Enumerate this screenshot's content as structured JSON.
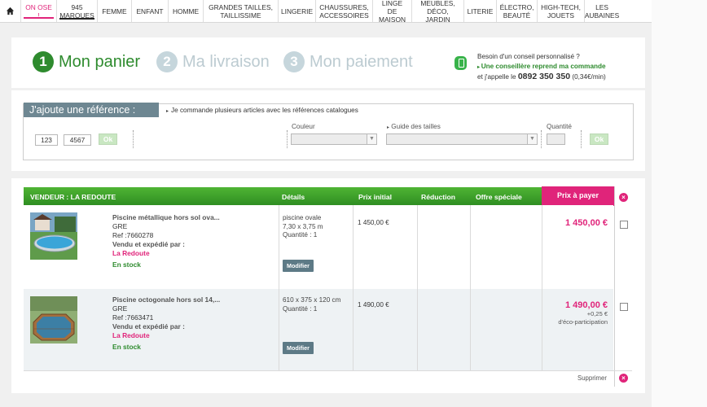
{
  "nav": {
    "items": [
      {
        "label": "ON OSE !"
      },
      {
        "label": "945\nMARQUES"
      },
      {
        "label": "FEMME"
      },
      {
        "label": "ENFANT"
      },
      {
        "label": "HOMME"
      },
      {
        "label": "GRANDES TAILLES,\nTAILLISSIME"
      },
      {
        "label": "LINGERIE"
      },
      {
        "label": "CHAUSSURES,\nACCESSOIRES"
      },
      {
        "label": "LINGE DE\nMAISON"
      },
      {
        "label": "MEUBLES,\nDÉCO, JARDIN"
      },
      {
        "label": "LITERIE"
      },
      {
        "label": "ÉLECTRO,\nBEAUTÉ"
      },
      {
        "label": "HIGH-TECH,\nJOUETS"
      },
      {
        "label": "LES\nAUBAINES"
      }
    ]
  },
  "steps": {
    "s1": {
      "num": "1",
      "label": "Mon panier"
    },
    "s2": {
      "num": "2",
      "label": "Ma livraison"
    },
    "s3": {
      "num": "3",
      "label": "Mon paiement"
    }
  },
  "help": {
    "line1": "Besoin d'un conseil personnalisé ?",
    "line2": "Une conseillère reprend ma commande",
    "line3_prefix": "et j'appelle le",
    "phone": "0892 350 350",
    "rate": "(0,34€/min)"
  },
  "reference": {
    "title": "J'ajoute une référence :",
    "link": "Je commande plusieurs articles avec les références catalogues",
    "ref_part1": "123",
    "ref_part2": "4567",
    "ok1": "Ok",
    "couleur_label": "Couleur",
    "guide_label": "Guide des tailles",
    "quantite_label": "Quantité",
    "ok2": "Ok"
  },
  "cart": {
    "headers": {
      "vendor": "VENDEUR : LA REDOUTE",
      "details": "Détails",
      "prix_initial": "Prix initial",
      "reduction": "Réduction",
      "offre": "Offre spéciale",
      "prix_payer": "Prix à payer"
    },
    "items": [
      {
        "name": "Piscine métallique hors sol ova...",
        "brand": "GRE",
        "ref": "Ref :7660278",
        "sold_by": "Vendu et expédié par :",
        "seller": "La Redoute",
        "stock": "En stock",
        "details_1": "piscine ovale",
        "details_2": "7,30 x 3,75 m",
        "details_3": "Quantité : 1",
        "modify": "Modifier",
        "prix_initial": "1 450,00 €",
        "prix_payer": "1 450,00 €"
      },
      {
        "name": "Piscine octogonale hors sol 14,...",
        "brand": "GRE",
        "ref": "Ref :7663471",
        "sold_by": "Vendu et expédié par :",
        "seller": "La Redoute",
        "stock": "En stock",
        "details_1": "610 x 375 x 120 cm",
        "details_2": "Quantité : 1",
        "modify": "Modifier",
        "prix_initial": "1 490,00 €",
        "prix_payer": "1 490,00 €",
        "eco": "+0,25 €",
        "eco_label": "d'éco-participation"
      }
    ],
    "delete_label": "Supprimer"
  },
  "colors": {
    "brand_pink": "#e0247a",
    "brand_green": "#2e8b2e",
    "header_green": "#3fa32b",
    "slate": "#6e8792"
  }
}
